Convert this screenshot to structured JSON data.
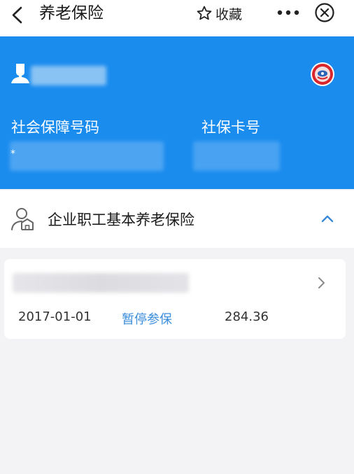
{
  "nav": {
    "title": "养老保险",
    "favorite_label": "收藏",
    "icons": {
      "back": "chevron-left-icon",
      "favorite": "star-outline-icon",
      "more": "ellipsis-icon",
      "close": "close-circle-icon"
    }
  },
  "user_card": {
    "ssn_label": "社会保障号码",
    "card_label": "社保卡号",
    "ssn_prefix": "*",
    "background_color": "#1a8cee",
    "icons": {
      "avatar": "person-silhouette-icon",
      "seal": "insurance-seal-icon"
    }
  },
  "section": {
    "title": "企业职工基本养老保险",
    "expanded": true,
    "icons": {
      "leading": "person-house-icon",
      "toggle": "chevron-up-icon"
    }
  },
  "record": {
    "start_date": "2017-01-01",
    "status": "暂停参保",
    "status_color": "#3c8edc",
    "amount": "284.36",
    "icons": {
      "detail": "chevron-right-icon"
    }
  }
}
